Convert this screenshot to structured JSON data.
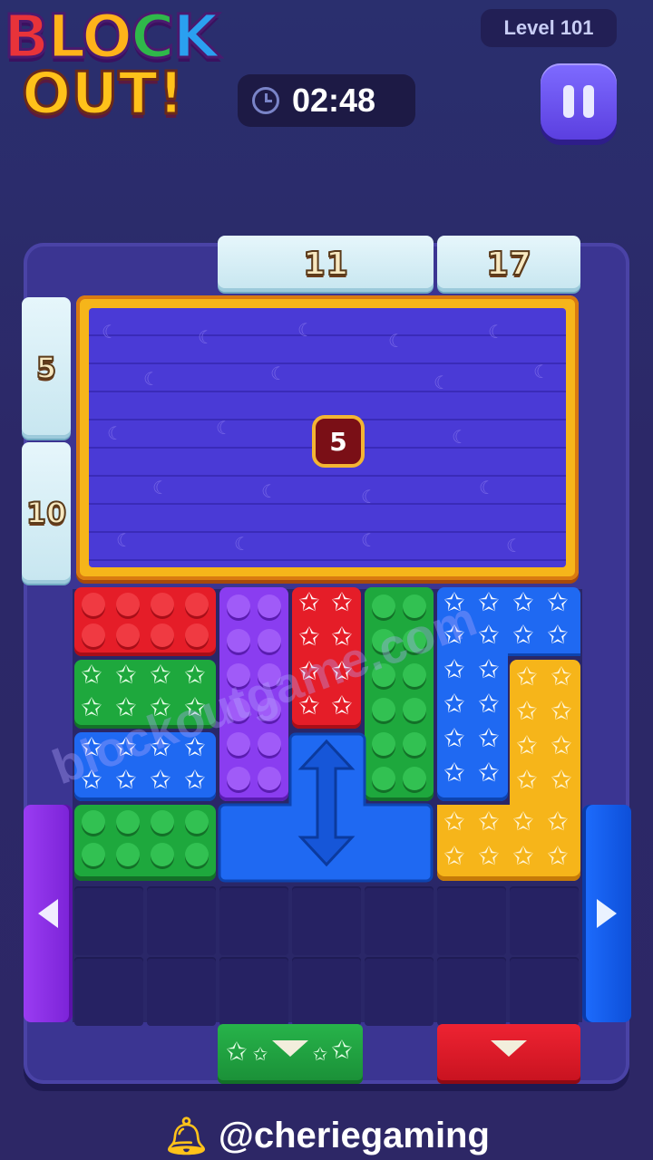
{
  "logo": {
    "line1": [
      "B",
      "L",
      "O",
      "C",
      "K"
    ],
    "line2": "OUT!",
    "colors": [
      "#e8333a",
      "#ffb31a",
      "#ffb31a",
      "#2fb84a",
      "#2aa0f0"
    ]
  },
  "level": {
    "label": "Level 101"
  },
  "timer": {
    "icon": "clock-icon",
    "value": "02:48"
  },
  "pause": {
    "icon": "pause-icon"
  },
  "gates": {
    "top_left": "11",
    "top_right": "17",
    "left_top": "5",
    "left_bottom": "10"
  },
  "frozen_block": {
    "count": "5"
  },
  "watermark": "blockoutgame.com",
  "footer": {
    "icon": "bell-icon",
    "handle": "@cheriegaming"
  },
  "colors": {
    "red": "#e51d28",
    "green": "#1ea83d",
    "purple": "#8a3df0",
    "blue": "#1f69f2",
    "yellow": "#f6b51a"
  }
}
